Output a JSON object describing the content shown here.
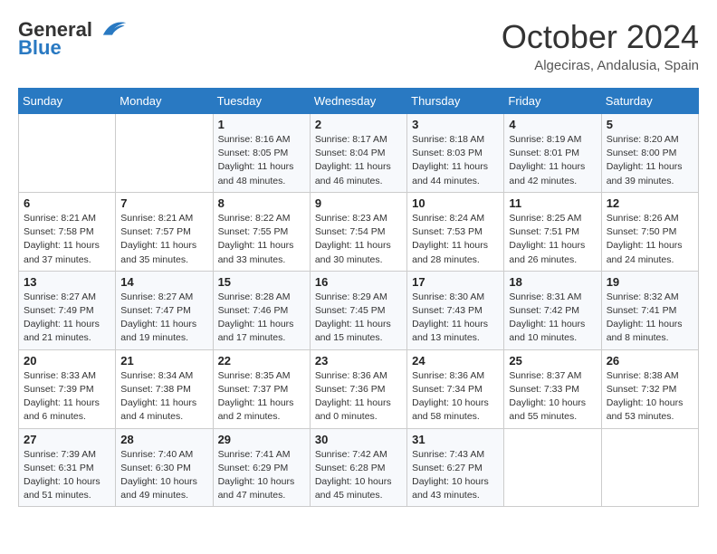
{
  "logo": {
    "line1": "General",
    "line2": "Blue"
  },
  "title": "October 2024",
  "location": "Algeciras, Andalusia, Spain",
  "weekdays": [
    "Sunday",
    "Monday",
    "Tuesday",
    "Wednesday",
    "Thursday",
    "Friday",
    "Saturday"
  ],
  "weeks": [
    [
      null,
      null,
      {
        "day": 1,
        "sunrise": "8:16 AM",
        "sunset": "8:05 PM",
        "daylight": "11 hours and 48 minutes."
      },
      {
        "day": 2,
        "sunrise": "8:17 AM",
        "sunset": "8:04 PM",
        "daylight": "11 hours and 46 minutes."
      },
      {
        "day": 3,
        "sunrise": "8:18 AM",
        "sunset": "8:03 PM",
        "daylight": "11 hours and 44 minutes."
      },
      {
        "day": 4,
        "sunrise": "8:19 AM",
        "sunset": "8:01 PM",
        "daylight": "11 hours and 42 minutes."
      },
      {
        "day": 5,
        "sunrise": "8:20 AM",
        "sunset": "8:00 PM",
        "daylight": "11 hours and 39 minutes."
      }
    ],
    [
      {
        "day": 6,
        "sunrise": "8:21 AM",
        "sunset": "7:58 PM",
        "daylight": "11 hours and 37 minutes."
      },
      {
        "day": 7,
        "sunrise": "8:21 AM",
        "sunset": "7:57 PM",
        "daylight": "11 hours and 35 minutes."
      },
      {
        "day": 8,
        "sunrise": "8:22 AM",
        "sunset": "7:55 PM",
        "daylight": "11 hours and 33 minutes."
      },
      {
        "day": 9,
        "sunrise": "8:23 AM",
        "sunset": "7:54 PM",
        "daylight": "11 hours and 30 minutes."
      },
      {
        "day": 10,
        "sunrise": "8:24 AM",
        "sunset": "7:53 PM",
        "daylight": "11 hours and 28 minutes."
      },
      {
        "day": 11,
        "sunrise": "8:25 AM",
        "sunset": "7:51 PM",
        "daylight": "11 hours and 26 minutes."
      },
      {
        "day": 12,
        "sunrise": "8:26 AM",
        "sunset": "7:50 PM",
        "daylight": "11 hours and 24 minutes."
      }
    ],
    [
      {
        "day": 13,
        "sunrise": "8:27 AM",
        "sunset": "7:49 PM",
        "daylight": "11 hours and 21 minutes."
      },
      {
        "day": 14,
        "sunrise": "8:27 AM",
        "sunset": "7:47 PM",
        "daylight": "11 hours and 19 minutes."
      },
      {
        "day": 15,
        "sunrise": "8:28 AM",
        "sunset": "7:46 PM",
        "daylight": "11 hours and 17 minutes."
      },
      {
        "day": 16,
        "sunrise": "8:29 AM",
        "sunset": "7:45 PM",
        "daylight": "11 hours and 15 minutes."
      },
      {
        "day": 17,
        "sunrise": "8:30 AM",
        "sunset": "7:43 PM",
        "daylight": "11 hours and 13 minutes."
      },
      {
        "day": 18,
        "sunrise": "8:31 AM",
        "sunset": "7:42 PM",
        "daylight": "11 hours and 10 minutes."
      },
      {
        "day": 19,
        "sunrise": "8:32 AM",
        "sunset": "7:41 PM",
        "daylight": "11 hours and 8 minutes."
      }
    ],
    [
      {
        "day": 20,
        "sunrise": "8:33 AM",
        "sunset": "7:39 PM",
        "daylight": "11 hours and 6 minutes."
      },
      {
        "day": 21,
        "sunrise": "8:34 AM",
        "sunset": "7:38 PM",
        "daylight": "11 hours and 4 minutes."
      },
      {
        "day": 22,
        "sunrise": "8:35 AM",
        "sunset": "7:37 PM",
        "daylight": "11 hours and 2 minutes."
      },
      {
        "day": 23,
        "sunrise": "8:36 AM",
        "sunset": "7:36 PM",
        "daylight": "11 hours and 0 minutes."
      },
      {
        "day": 24,
        "sunrise": "8:36 AM",
        "sunset": "7:34 PM",
        "daylight": "10 hours and 58 minutes."
      },
      {
        "day": 25,
        "sunrise": "8:37 AM",
        "sunset": "7:33 PM",
        "daylight": "10 hours and 55 minutes."
      },
      {
        "day": 26,
        "sunrise": "8:38 AM",
        "sunset": "7:32 PM",
        "daylight": "10 hours and 53 minutes."
      }
    ],
    [
      {
        "day": 27,
        "sunrise": "7:39 AM",
        "sunset": "6:31 PM",
        "daylight": "10 hours and 51 minutes."
      },
      {
        "day": 28,
        "sunrise": "7:40 AM",
        "sunset": "6:30 PM",
        "daylight": "10 hours and 49 minutes."
      },
      {
        "day": 29,
        "sunrise": "7:41 AM",
        "sunset": "6:29 PM",
        "daylight": "10 hours and 47 minutes."
      },
      {
        "day": 30,
        "sunrise": "7:42 AM",
        "sunset": "6:28 PM",
        "daylight": "10 hours and 45 minutes."
      },
      {
        "day": 31,
        "sunrise": "7:43 AM",
        "sunset": "6:27 PM",
        "daylight": "10 hours and 43 minutes."
      },
      null,
      null
    ]
  ]
}
